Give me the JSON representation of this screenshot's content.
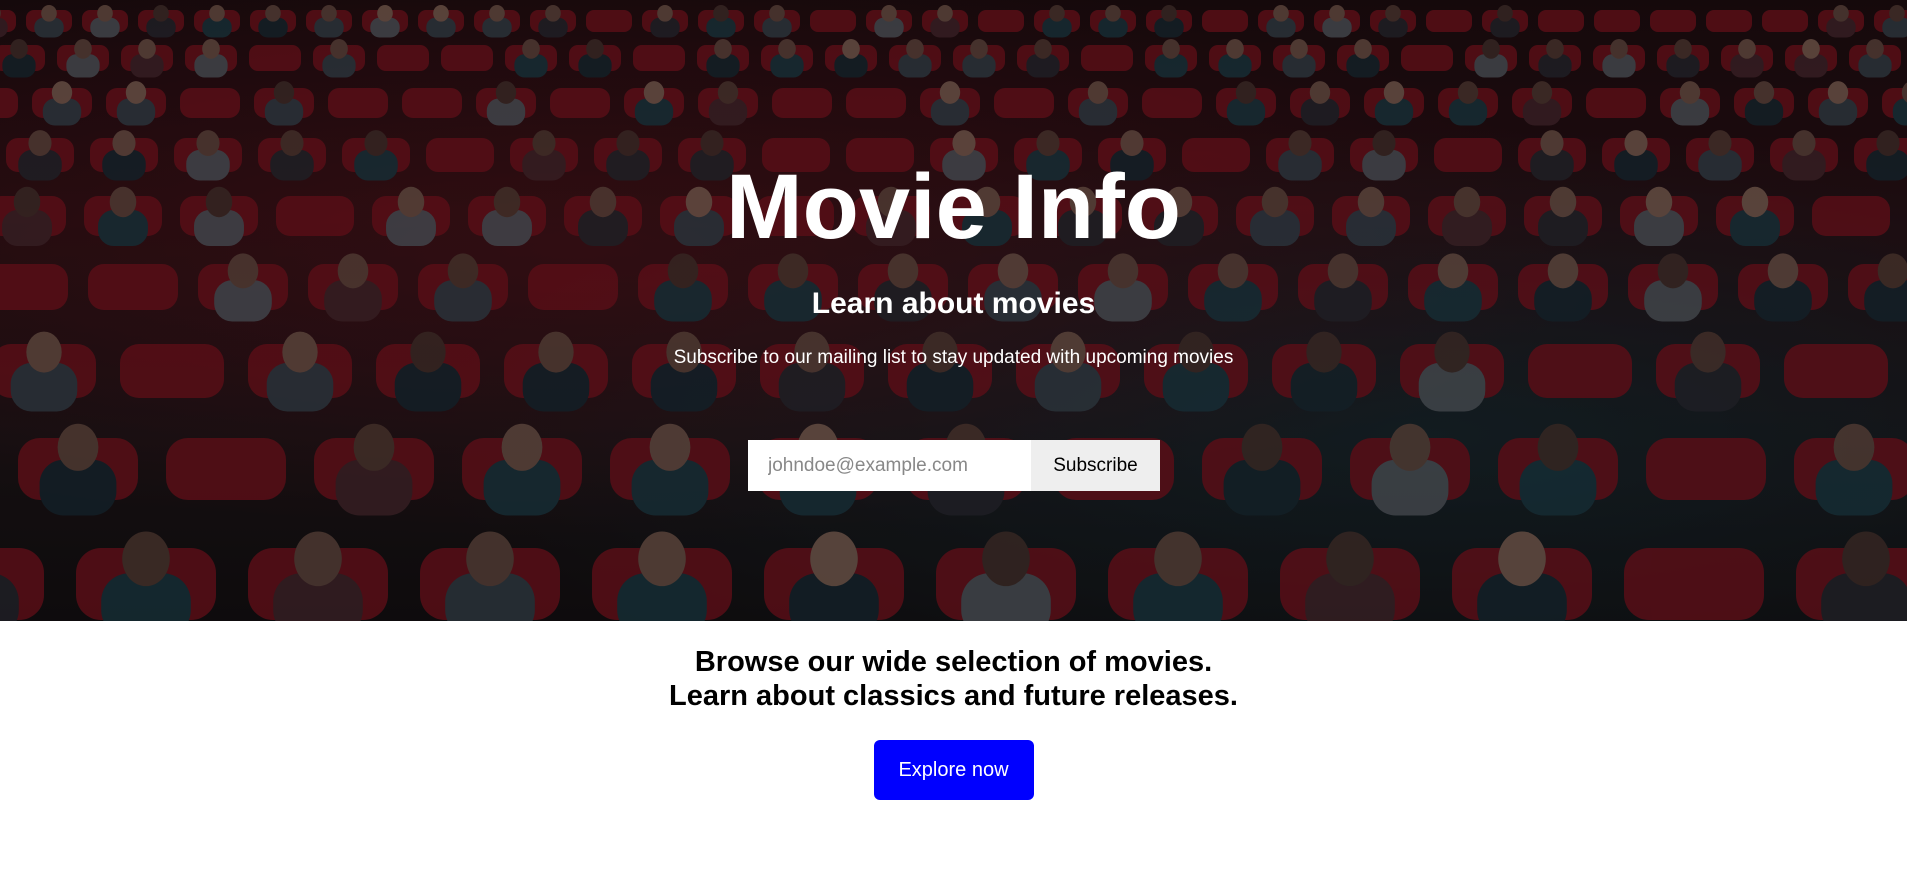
{
  "hero": {
    "title": "Movie Info",
    "subtitle": "Learn about movies",
    "text": "Subscribe to our mailing list to stay updated with upcoming movies",
    "email_placeholder": "johndoe@example.com",
    "subscribe_label": "Subscribe",
    "background_icon": "theater-audience-image"
  },
  "browse": {
    "line1": "Browse our wide selection of movies.",
    "line2": "Learn about classics and future releases.",
    "explore_label": "Explore now"
  },
  "colors": {
    "accent": "#0000ff",
    "seat_red": "#7a1420",
    "text_light": "#ffffff",
    "text_dark": "#000000"
  }
}
